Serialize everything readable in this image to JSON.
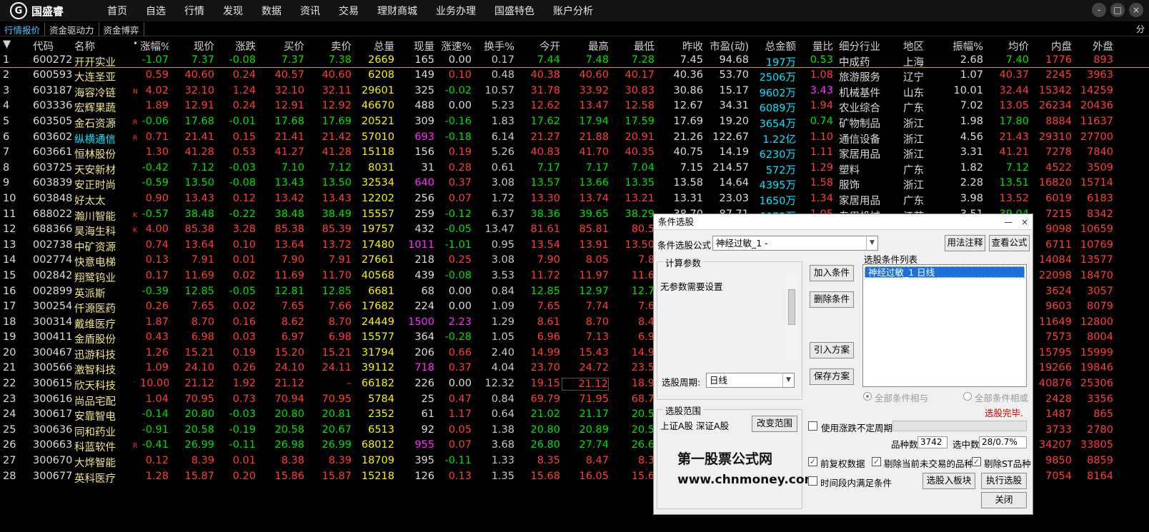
{
  "app": {
    "logo_text": "国盛睿",
    "logo_mark": "G"
  },
  "nav": [
    "首页",
    "自选",
    "行情",
    "发现",
    "数据",
    "资讯",
    "交易",
    "理财商城",
    "业务办理",
    "国盛特色",
    "账户分析"
  ],
  "window_controls": [
    "-",
    "□",
    "×"
  ],
  "tabs": [
    "行情报价",
    "资金驱动力",
    "资金博弈"
  ],
  "tabs_right": "分",
  "columns": {
    "idx": "▼",
    "code": "代码",
    "name": "名称",
    "sort": "•",
    "chg": "涨幅%",
    "price": "现价",
    "delta": "涨跌",
    "bid": "买价",
    "ask": "卖价",
    "vol": "总量",
    "cur": "现量",
    "spd": "涨速%",
    "turn": "换手%",
    "open": "今开",
    "high": "最高",
    "low": "最低",
    "prev": "昨收",
    "pe": "市盈(动)",
    "amt": "总金额",
    "ratio": "量比",
    "ind": "细分行业",
    "reg": "地区",
    "amp": "振幅%",
    "avg": "均价",
    "inner": "内盘",
    "outer": "外盘"
  },
  "rows": [
    {
      "i": "1",
      "code": "600272",
      "name": "开开实业",
      "flag": "",
      "chg": "-1.07",
      "price": "7.37",
      "delta": "-0.08",
      "bid": "7.37",
      "ask": "7.38",
      "vol": "2669",
      "cur": "165",
      "spd": "0.00",
      "turn": "0.17",
      "open": "7.44",
      "high": "7.48",
      "low": "7.28",
      "prev": "7.45",
      "pe": "94.68",
      "amt": "197万",
      "ratio": "0.53",
      "ind": "中成药",
      "reg": "上海",
      "amp": "2.68",
      "avg": "7.40",
      "inner": "1776",
      "outer": "893"
    },
    {
      "i": "2",
      "code": "600593",
      "name": "大连圣亚",
      "flag": "",
      "chg": "0.59",
      "price": "40.60",
      "delta": "0.24",
      "bid": "40.57",
      "ask": "40.60",
      "vol": "6208",
      "cur": "149",
      "spd": "0.10",
      "turn": "0.48",
      "open": "40.38",
      "high": "40.60",
      "low": "40.17",
      "prev": "40.36",
      "pe": "53.70",
      "amt": "2506万",
      "ratio": "1.08",
      "ind": "旅游服务",
      "reg": "辽宁",
      "amp": "1.07",
      "avg": "40.37",
      "inner": "2245",
      "outer": "3963"
    },
    {
      "i": "3",
      "code": "603187",
      "name": "海容冷链",
      "flag": "N",
      "chg": "4.02",
      "price": "32.10",
      "delta": "1.24",
      "bid": "32.10",
      "ask": "32.11",
      "vol": "29601",
      "cur": "325",
      "spd": "-0.02",
      "turn": "10.57",
      "open": "31.78",
      "high": "33.92",
      "low": "30.83",
      "prev": "30.86",
      "pe": "15.17",
      "amt": "9602万",
      "ratio": "3.43",
      "ind": "机械基件",
      "reg": "山东",
      "amp": "10.01",
      "avg": "32.44",
      "inner": "15342",
      "outer": "14259"
    },
    {
      "i": "4",
      "code": "603336",
      "name": "宏辉果蔬",
      "flag": "",
      "chg": "1.89",
      "price": "12.91",
      "delta": "0.24",
      "bid": "12.91",
      "ask": "12.92",
      "vol": "46670",
      "cur": "488",
      "spd": "0.00",
      "turn": "5.23",
      "open": "12.62",
      "high": "13.47",
      "low": "12.58",
      "prev": "12.67",
      "pe": "34.31",
      "amt": "6089万",
      "ratio": "1.94",
      "ind": "农业综合",
      "reg": "广东",
      "amp": "7.02",
      "avg": "13.05",
      "inner": "26234",
      "outer": "20436"
    },
    {
      "i": "5",
      "code": "603505",
      "name": "金石资源",
      "flag": "R",
      "chg": "-0.06",
      "price": "17.68",
      "delta": "-0.01",
      "bid": "17.68",
      "ask": "17.69",
      "vol": "20521",
      "cur": "309",
      "spd": "-0.16",
      "turn": "1.83",
      "open": "17.62",
      "high": "17.94",
      "low": "17.59",
      "prev": "17.69",
      "pe": "19.20",
      "amt": "3654万",
      "ratio": "0.74",
      "ind": "矿物制品",
      "reg": "浙江",
      "amp": "1.98",
      "avg": "17.80",
      "inner": "8884",
      "outer": "11637"
    },
    {
      "i": "6",
      "code": "603602",
      "name": "纵横通信",
      "flag": "R",
      "chg": "0.71",
      "price": "21.41",
      "delta": "0.15",
      "bid": "21.41",
      "ask": "21.42",
      "vol": "57010",
      "cur": "693",
      "spd": "-0.18",
      "turn": "6.14",
      "open": "21.27",
      "high": "21.88",
      "low": "20.91",
      "prev": "21.26",
      "pe": "122.67",
      "amt": "1.22亿",
      "ratio": "1.10",
      "ind": "通信设备",
      "reg": "浙江",
      "amp": "4.56",
      "avg": "21.43",
      "inner": "29310",
      "outer": "27700"
    },
    {
      "i": "7",
      "code": "603661",
      "name": "恒林股份",
      "flag": "",
      "chg": "1.30",
      "price": "41.28",
      "delta": "0.53",
      "bid": "41.27",
      "ask": "41.28",
      "vol": "15118",
      "cur": "156",
      "spd": "0.19",
      "turn": "5.26",
      "open": "40.83",
      "high": "41.70",
      "low": "40.35",
      "prev": "40.75",
      "pe": "14.19",
      "amt": "6230万",
      "ratio": "1.11",
      "ind": "家居用品",
      "reg": "浙江",
      "amp": "3.31",
      "avg": "41.21",
      "inner": "7278",
      "outer": "7840"
    },
    {
      "i": "8",
      "code": "603725",
      "name": "天安新材",
      "flag": "",
      "chg": "-0.42",
      "price": "7.12",
      "delta": "-0.03",
      "bid": "7.10",
      "ask": "7.12",
      "vol": "8031",
      "cur": "31",
      "spd": "0.28",
      "turn": "0.61",
      "open": "7.17",
      "high": "7.17",
      "low": "7.04",
      "prev": "7.15",
      "pe": "214.57",
      "amt": "572万",
      "ratio": "1.29",
      "ind": "塑料",
      "reg": "广东",
      "amp": "1.82",
      "avg": "7.12",
      "inner": "4522",
      "outer": "3509"
    },
    {
      "i": "9",
      "code": "603839",
      "name": "安正时尚",
      "flag": "",
      "chg": "-0.59",
      "price": "13.50",
      "delta": "-0.08",
      "bid": "13.43",
      "ask": "13.50",
      "vol": "32534",
      "cur": "640",
      "spd": "0.37",
      "turn": "3.08",
      "open": "13.57",
      "high": "13.66",
      "low": "13.35",
      "prev": "13.58",
      "pe": "14.64",
      "amt": "4395万",
      "ratio": "1.58",
      "ind": "服饰",
      "reg": "浙江",
      "amp": "2.28",
      "avg": "13.51",
      "inner": "16820",
      "outer": "15714"
    },
    {
      "i": "10",
      "code": "603848",
      "name": "好太太",
      "flag": "",
      "chg": "0.90",
      "price": "13.43",
      "delta": "0.12",
      "bid": "13.42",
      "ask": "13.43",
      "vol": "12202",
      "cur": "256",
      "spd": "0.07",
      "turn": "1.72",
      "open": "13.30",
      "high": "13.74",
      "low": "13.21",
      "prev": "13.31",
      "pe": "23.03",
      "amt": "1650万",
      "ratio": "1.34",
      "ind": "家居用品",
      "reg": "广东",
      "amp": "3.98",
      "avg": "13.52",
      "inner": "6019",
      "outer": "6183"
    },
    {
      "i": "11",
      "code": "688022",
      "name": "瀚川智能",
      "flag": "K",
      "chg": "-0.57",
      "price": "38.48",
      "delta": "-0.22",
      "bid": "38.48",
      "ask": "38.49",
      "vol": "15557",
      "cur": "259",
      "spd": "-0.12",
      "turn": "6.37",
      "open": "38.36",
      "high": "39.65",
      "low": "38.29",
      "prev": "38.70",
      "pe": "87.71",
      "amt": "6073万",
      "ratio": "1.05",
      "ind": "专用机械",
      "reg": "江苏",
      "amp": "3.51",
      "avg": "39.04",
      "inner": "7215",
      "outer": "8342"
    },
    {
      "i": "12",
      "code": "688366",
      "name": "昊海生科",
      "flag": "K",
      "chg": "4.00",
      "price": "85.38",
      "delta": "3.28",
      "bid": "85.38",
      "ask": "85.39",
      "vol": "19757",
      "cur": "432",
      "spd": "-0.05",
      "turn": "13.47",
      "open": "81.61",
      "high": "85.81",
      "low": "80.5",
      "prev": "",
      "pe": "",
      "amt": "",
      "ratio": "",
      "ind": "",
      "reg": "",
      "amp": "",
      "avg": "",
      "inner": "9098",
      "outer": "10659"
    },
    {
      "i": "13",
      "code": "002738",
      "name": "中矿资源",
      "flag": "",
      "chg": "0.74",
      "price": "13.64",
      "delta": "0.10",
      "bid": "13.64",
      "ask": "13.72",
      "vol": "17480",
      "cur": "1011",
      "spd": "-1.01",
      "turn": "0.95",
      "open": "13.54",
      "high": "13.91",
      "low": "13.50",
      "prev": "",
      "pe": "",
      "amt": "",
      "ratio": "",
      "ind": "",
      "reg": "",
      "amp": "",
      "avg": "",
      "inner": "6711",
      "outer": "10769"
    },
    {
      "i": "14",
      "code": "002774",
      "name": "快意电梯",
      "flag": "",
      "chg": "0.13",
      "price": "7.91",
      "delta": "0.01",
      "bid": "7.90",
      "ask": "7.91",
      "vol": "27661",
      "cur": "218",
      "spd": "0.25",
      "turn": "3.08",
      "open": "7.90",
      "high": "8.05",
      "low": "7.8",
      "prev": "",
      "pe": "",
      "amt": "",
      "ratio": "",
      "ind": "",
      "reg": "",
      "amp": "",
      "avg": "",
      "inner": "14084",
      "outer": "13577"
    },
    {
      "i": "15",
      "code": "002842",
      "name": "翔鹭钨业",
      "flag": "",
      "chg": "0.17",
      "price": "11.69",
      "delta": "0.02",
      "bid": "11.69",
      "ask": "11.70",
      "vol": "40568",
      "cur": "439",
      "spd": "-0.08",
      "turn": "3.53",
      "open": "11.72",
      "high": "11.97",
      "low": "11.6",
      "prev": "",
      "pe": "",
      "amt": "",
      "ratio": "",
      "ind": "",
      "reg": "",
      "amp": "",
      "avg": "",
      "inner": "22098",
      "outer": "18470"
    },
    {
      "i": "16",
      "code": "002899",
      "name": "英派斯",
      "flag": "",
      "chg": "-0.39",
      "price": "12.85",
      "delta": "-0.05",
      "bid": "12.81",
      "ask": "12.85",
      "vol": "6681",
      "cur": "68",
      "spd": "0.00",
      "turn": "0.84",
      "open": "12.85",
      "high": "12.97",
      "low": "12.7",
      "prev": "",
      "pe": "",
      "amt": "",
      "ratio": "",
      "ind": "",
      "reg": "",
      "amp": "",
      "avg": "",
      "inner": "3624",
      "outer": "3057"
    },
    {
      "i": "17",
      "code": "300254",
      "name": "仟源医药",
      "flag": "",
      "chg": "0.26",
      "price": "7.65",
      "delta": "0.02",
      "bid": "7.65",
      "ask": "7.66",
      "vol": "17682",
      "cur": "224",
      "spd": "0.00",
      "turn": "1.09",
      "open": "7.65",
      "high": "7.74",
      "low": "7.6",
      "prev": "",
      "pe": "",
      "amt": "",
      "ratio": "",
      "ind": "",
      "reg": "",
      "amp": "",
      "avg": "",
      "inner": "9603",
      "outer": "8079"
    },
    {
      "i": "18",
      "code": "300314",
      "name": "戴维医疗",
      "flag": "",
      "chg": "1.87",
      "price": "8.70",
      "delta": "0.16",
      "bid": "8.62",
      "ask": "8.70",
      "vol": "24449",
      "cur": "1500",
      "spd": "2.23",
      "turn": "1.29",
      "open": "8.61",
      "high": "8.70",
      "low": "8.4",
      "prev": "",
      "pe": "",
      "amt": "",
      "ratio": "",
      "ind": "",
      "reg": "",
      "amp": "",
      "avg": "",
      "inner": "11649",
      "outer": "12800"
    },
    {
      "i": "19",
      "code": "300411",
      "name": "金盾股份",
      "flag": "",
      "chg": "0.43",
      "price": "6.98",
      "delta": "0.03",
      "bid": "6.97",
      "ask": "6.98",
      "vol": "15577",
      "cur": "364",
      "spd": "-0.28",
      "turn": "1.05",
      "open": "6.96",
      "high": "7.13",
      "low": "6.9",
      "prev": "",
      "pe": "",
      "amt": "",
      "ratio": "",
      "ind": "",
      "reg": "",
      "amp": "",
      "avg": "",
      "inner": "7573",
      "outer": "8004"
    },
    {
      "i": "20",
      "code": "300467",
      "name": "迅游科技",
      "flag": "",
      "chg": "1.26",
      "price": "15.21",
      "delta": "0.19",
      "bid": "15.20",
      "ask": "15.21",
      "vol": "31794",
      "cur": "206",
      "spd": "0.66",
      "turn": "2.40",
      "open": "14.99",
      "high": "15.43",
      "low": "14.9",
      "prev": "",
      "pe": "",
      "amt": "",
      "ratio": "",
      "ind": "",
      "reg": "",
      "amp": "",
      "avg": "",
      "inner": "15795",
      "outer": "15999"
    },
    {
      "i": "21",
      "code": "300566",
      "name": "激智科技",
      "flag": "",
      "chg": "1.09",
      "price": "24.10",
      "delta": "0.26",
      "bid": "24.10",
      "ask": "24.11",
      "vol": "39112",
      "cur": "718",
      "spd": "0.37",
      "turn": "4.04",
      "open": "23.70",
      "high": "24.72",
      "low": "23.5",
      "prev": "",
      "pe": "",
      "amt": "",
      "ratio": "",
      "ind": "",
      "reg": "",
      "amp": "",
      "avg": "",
      "inner": "19266",
      "outer": "19846"
    },
    {
      "i": "22",
      "code": "300615",
      "name": "欣天科技",
      "flag": "`",
      "chg": "10.00",
      "price": "21.12",
      "delta": "1.92",
      "bid": "21.12",
      "ask": "–",
      "vol": "66182",
      "cur": "226",
      "spd": "0.00",
      "turn": "12.32",
      "open": "19.15",
      "high": "21.12",
      "low": "18.9",
      "prev": "",
      "pe": "",
      "amt": "",
      "ratio": "",
      "ind": "",
      "reg": "",
      "amp": "",
      "avg": "",
      "inner": "40876",
      "outer": "25306"
    },
    {
      "i": "23",
      "code": "300616",
      "name": "尚品宅配",
      "flag": "",
      "chg": "1.04",
      "price": "70.95",
      "delta": "0.73",
      "bid": "70.94",
      "ask": "70.95",
      "vol": "5784",
      "cur": "25",
      "spd": "0.47",
      "turn": "0.84",
      "open": "69.79",
      "high": "71.95",
      "low": "68.7",
      "prev": "",
      "pe": "",
      "amt": "",
      "ratio": "",
      "ind": "",
      "reg": "",
      "amp": "",
      "avg": "",
      "inner": "2428",
      "outer": "3356"
    },
    {
      "i": "24",
      "code": "300617",
      "name": "安靠智电",
      "flag": "",
      "chg": "-0.14",
      "price": "20.80",
      "delta": "-0.03",
      "bid": "20.80",
      "ask": "20.81",
      "vol": "2352",
      "cur": "61",
      "spd": "1.17",
      "turn": "0.64",
      "open": "21.02",
      "high": "21.17",
      "low": "20.5",
      "prev": "",
      "pe": "",
      "amt": "",
      "ratio": "",
      "ind": "",
      "reg": "",
      "amp": "",
      "avg": "",
      "inner": "1487",
      "outer": "865"
    },
    {
      "i": "25",
      "code": "300636",
      "name": "同和药业",
      "flag": "",
      "chg": "-0.91",
      "price": "20.58",
      "delta": "-0.19",
      "bid": "20.58",
      "ask": "20.67",
      "vol": "6513",
      "cur": "92",
      "spd": "0.05",
      "turn": "1.38",
      "open": "20.80",
      "high": "20.89",
      "low": "20.5",
      "prev": "",
      "pe": "",
      "amt": "",
      "ratio": "",
      "ind": "",
      "reg": "",
      "amp": "",
      "avg": "",
      "inner": "3733",
      "outer": "2780"
    },
    {
      "i": "26",
      "code": "300663",
      "name": "科蓝软件",
      "flag": "R",
      "chg": "-0.41",
      "price": "26.99",
      "delta": "-0.11",
      "bid": "26.98",
      "ask": "26.99",
      "vol": "68012",
      "cur": "955",
      "spd": "0.07",
      "turn": "3.68",
      "open": "26.80",
      "high": "27.74",
      "low": "26.6",
      "prev": "",
      "pe": "",
      "amt": "",
      "ratio": "",
      "ind": "",
      "reg": "",
      "amp": "",
      "avg": "",
      "inner": "34207",
      "outer": "33805"
    },
    {
      "i": "27",
      "code": "300670",
      "name": "大烨智能",
      "flag": "",
      "chg": "0.12",
      "price": "8.39",
      "delta": "0.01",
      "bid": "8.38",
      "ask": "8.39",
      "vol": "18709",
      "cur": "395",
      "spd": "-0.11",
      "turn": "1.33",
      "open": "8.35",
      "high": "8.47",
      "low": "8.3",
      "prev": "",
      "pe": "",
      "amt": "",
      "ratio": "",
      "ind": "",
      "reg": "",
      "amp": "",
      "avg": "",
      "inner": "9850",
      "outer": "8859"
    },
    {
      "i": "28",
      "code": "300677",
      "name": "英科医疗",
      "flag": "",
      "chg": "1.28",
      "price": "15.87",
      "delta": "0.20",
      "bid": "15.86",
      "ask": "15.87",
      "vol": "15218",
      "cur": "126",
      "spd": "0.13",
      "turn": "1.35",
      "open": "15.68",
      "high": "16.05",
      "low": "15.6",
      "prev": "",
      "pe": "",
      "amt": "",
      "ratio": "",
      "ind": "",
      "reg": "",
      "amp": "",
      "avg": "",
      "inner": "7054",
      "outer": "8164"
    }
  ],
  "colors": {
    "up": "#ff3c3c",
    "down": "#00e000",
    "flat": "#dcdcdc",
    "volume": "#f4f400",
    "amount": "#00e5ff",
    "highlight": "#ff2bff",
    "accent": "#1c70d8"
  },
  "dialog": {
    "title": "条件选股",
    "title_ctrls": [
      "—",
      "×"
    ],
    "formula_label": "条件选股公式",
    "formula_value": "神经过敏_1    -",
    "btn_usage": "用法注释",
    "btn_view": "查看公式",
    "calc_params_title": "计算参数",
    "no_params": "无参数需要设置",
    "btn_add": "加入条件",
    "btn_delete": "删除条件",
    "btn_import": "引入方案",
    "btn_save": "保存方案",
    "cond_list_label": "选股条件列表",
    "cond_item": "神经过敏_1   日线",
    "period_label": "选股周期:",
    "period_value": "日线",
    "radio_and": "全部条件相与",
    "radio_or": "全部条件相或",
    "status": "选股完毕.",
    "range_title": "选股范围",
    "range_value": "上证A股  深证A股",
    "btn_change_range": "改变范围",
    "chk_variable_period": "使用涨跌不定周期",
    "count_label": "品种数",
    "count_value": "3742",
    "selected_label": "选中数",
    "selected_value": "28/0.7%",
    "chk_prior_adj": "前复权数据",
    "chk_exclude_untraded": "剔除当前未交易的品种",
    "chk_exclude_st": "剔除ST品种",
    "chk_time_range": "时间段内满足条件",
    "btn_to_block": "选股入板块",
    "btn_execute": "执行选股",
    "btn_close": "关闭",
    "watermark_cn": "第一股票公式网",
    "watermark_url": "www.chnmoney.com"
  }
}
